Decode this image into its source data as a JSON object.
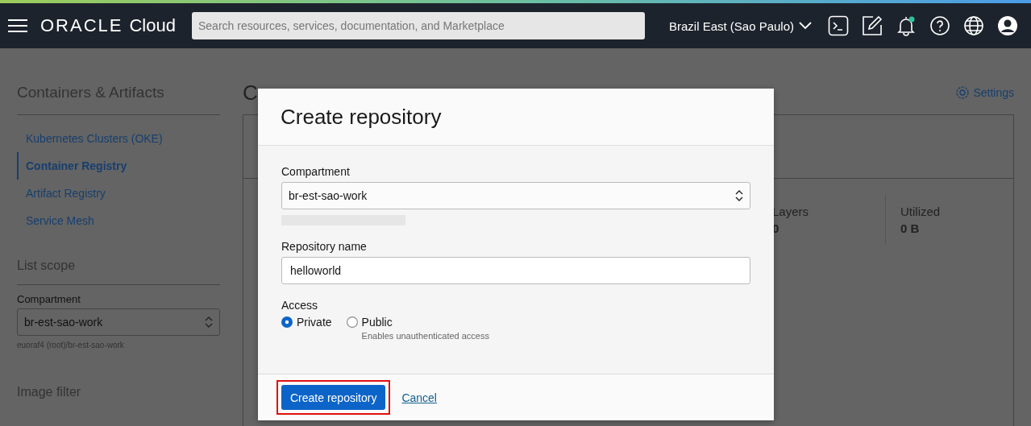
{
  "header": {
    "logo": {
      "brand": "ORACLE",
      "product": "Cloud"
    },
    "search": {
      "placeholder": "Search resources, services, documentation, and Marketplace"
    },
    "region": "Brazil East (Sao Paulo)",
    "notification_badge": true
  },
  "sidebar": {
    "title": "Containers & Artifacts",
    "items": [
      {
        "label": "Kubernetes Clusters (OKE)",
        "selected": false
      },
      {
        "label": "Container Registry",
        "selected": true
      },
      {
        "label": "Artifact Registry",
        "selected": false
      },
      {
        "label": "Service Mesh",
        "selected": false
      }
    ],
    "list_scope": {
      "title": "List scope",
      "compartment_label": "Compartment",
      "compartment_value": "br-est-sao-work",
      "compartment_path": "euoraf4 (root)/br-est-sao-work"
    },
    "image_filter_title": "Image filter"
  },
  "main": {
    "title": "C",
    "settings": "Settings",
    "stats": [
      {
        "label": "Layers",
        "value": "0"
      },
      {
        "label": "Utilized",
        "value": "0 B"
      }
    ]
  },
  "dialog": {
    "title": "Create repository",
    "compartment": {
      "label": "Compartment",
      "value": "br-est-sao-work"
    },
    "repository_name": {
      "label": "Repository name",
      "value": "helloworld"
    },
    "access": {
      "label": "Access",
      "options": [
        {
          "label": "Private",
          "selected": true
        },
        {
          "label": "Public",
          "selected": false,
          "hint": "Enables unauthenticated access"
        }
      ]
    },
    "primary_button": "Create repository",
    "primary_highlighted": true,
    "cancel": "Cancel"
  }
}
